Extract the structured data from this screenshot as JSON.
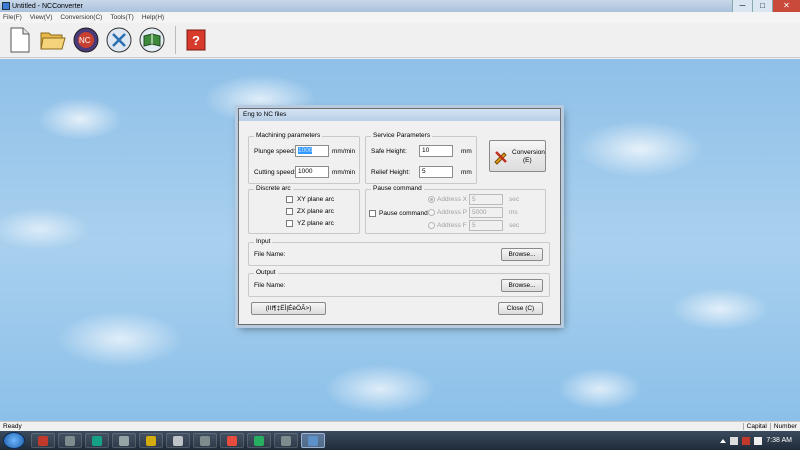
{
  "window": {
    "title": "Untitled - NCConverter",
    "controls": {
      "minimize": "─",
      "maximize": "□",
      "close": "✕"
    }
  },
  "menu": [
    "File(F)",
    "View(V)",
    "Conversion(C)",
    "Tools(T)",
    "Help(H)"
  ],
  "toolbar": {
    "icons": [
      "new-file-icon",
      "open-folder-icon",
      "nc-convert-icon",
      "dxf-icon",
      "book-icon",
      "help-icon"
    ],
    "help_glyph": "?"
  },
  "dialog": {
    "title": "Eng to NC files",
    "machining": {
      "legend": "Machining parameters",
      "plunge_label": "Plunge speed:",
      "plunge_value": "1000",
      "plunge_unit": "mm/min",
      "cutting_label": "Cutting speed:",
      "cutting_value": "1000",
      "cutting_unit": "mm/min"
    },
    "service": {
      "legend": "Service Parameters",
      "safe_label": "Safe Height:",
      "safe_value": "10",
      "safe_unit": "mm",
      "relief_label": "Relief Height:",
      "relief_value": "5",
      "relief_unit": "mm"
    },
    "conversion_button": {
      "line1": "Conversion",
      "line2": "(E)"
    },
    "discrete_arc": {
      "legend": "Discrete arc",
      "options": [
        "XY plane arc",
        "ZX plane arc",
        "YZ plane arc"
      ]
    },
    "pause": {
      "legend": "Pause command",
      "checkbox_label": "Pause command",
      "rows": [
        {
          "label": "Address X",
          "value": "5",
          "unit": "sec"
        },
        {
          "label": "Address P",
          "value": "5000",
          "unit": "ms"
        },
        {
          "label": "Address F",
          "value": "5",
          "unit": "sec"
        }
      ]
    },
    "input": {
      "legend": "Input",
      "file_label": "File Name:",
      "browse": "Browse..."
    },
    "output": {
      "legend": "Output",
      "file_label": "File Name:",
      "browse": "Browse..."
    },
    "garbled_button": "(III¶‡ËÌ|ÉèÖÃ>)",
    "close_button": "Close (C)"
  },
  "statusbar": {
    "left": "Ready",
    "right": [
      "Capital",
      "Number"
    ]
  },
  "taskbar": {
    "time": "7:38 AM",
    "active_index": 10
  }
}
